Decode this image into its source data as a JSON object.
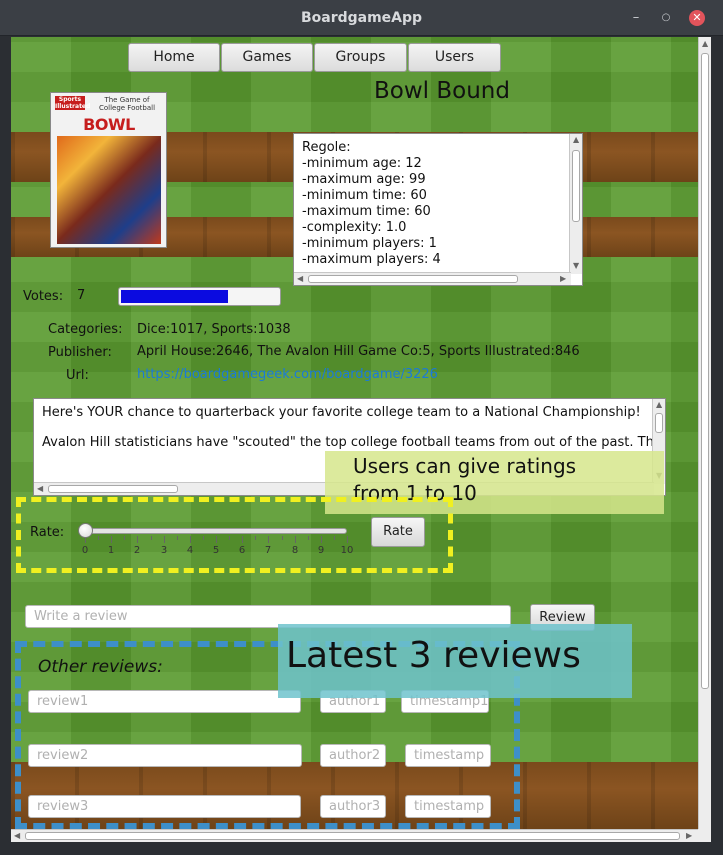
{
  "window": {
    "title": "BoardgameApp",
    "minimize_icon": "minimize-icon",
    "maximize_icon": "maximize-icon",
    "close_icon": "close-icon"
  },
  "nav": {
    "items": [
      {
        "label": "Home"
      },
      {
        "label": "Games"
      },
      {
        "label": "Groups"
      },
      {
        "label": "Users"
      }
    ]
  },
  "game": {
    "title": "Bowl Bound",
    "cover": {
      "brand": "Sports Illustrated",
      "subtitle": "The Game of College Football",
      "name": "BOWL BOUND"
    },
    "rules_text": "Regole:\n-minimum age: 12\n-maximum age: 99\n-minimum time: 60\n-maximum time: 60\n-complexity: 1.0\n-minimum players: 1\n-maximum players: 4\n-cooperative: No, all against all",
    "votes_label": "Votes:",
    "votes_value": "7",
    "votes_level": 0.68,
    "categories_label": "Categories:",
    "categories_value": "Dice:1017, Sports:1038",
    "publisher_label": "Publisher:",
    "publisher_value": "April House:2646, The Avalon Hill Game Co:5, Sports Illustrated:846",
    "url_label": "Url:",
    "url_value": "https://boardgamegeek.com/boardgame/3226",
    "description": {
      "p1": "Here's YOUR chance to quarterback your favorite college team to a National Championship!",
      "p2": "Avalon Hill statisticians have \"scouted\" the top college football teams from out of the past. Th"
    }
  },
  "annotations": {
    "ratings_callout_line1": "Users can give ratings",
    "ratings_callout_line2": "from 1 to 10",
    "reviews_callout": "Latest 3 reviews"
  },
  "rating": {
    "label": "Rate:",
    "value": 0,
    "min": 0,
    "max": 10,
    "tick_labels": [
      "0",
      "1",
      "2",
      "3",
      "4",
      "5",
      "6",
      "7",
      "8",
      "9",
      "10"
    ],
    "button_label": "Rate"
  },
  "review_form": {
    "placeholder": "Write a review",
    "button_label": "Review"
  },
  "reviews": {
    "heading": "Other reviews:",
    "rows": [
      {
        "review": "review1",
        "author": "author1",
        "timestamp": "timestamp1"
      },
      {
        "review": "review2",
        "author": "author2",
        "timestamp": "timestamp"
      },
      {
        "review": "review3",
        "author": "author3",
        "timestamp": "timestamp"
      }
    ]
  },
  "colors": {
    "vote_fill": "#0b0be0",
    "link": "#1a7ad8",
    "dash_yellow": "#f0f020",
    "dash_blue": "#3d8fc9"
  }
}
